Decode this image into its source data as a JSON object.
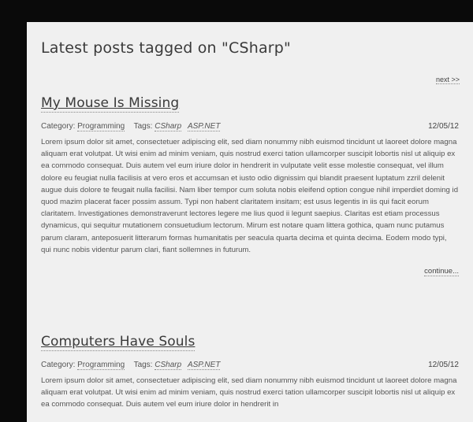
{
  "header": {
    "title": "Latest posts tagged on \"CSharp\"",
    "next_label": "next >>"
  },
  "posts": [
    {
      "title": "My Mouse Is Missing",
      "category_label": "Category:",
      "category": "Programming",
      "tags_label": "Tags:",
      "tags": [
        "CSharp",
        "ASP.NET"
      ],
      "date": "12/05/12",
      "body": "Lorem ipsum dolor sit amet, consectetuer adipiscing elit, sed diam nonummy nibh euismod tincidunt ut laoreet dolore magna aliquam erat volutpat. Ut wisi enim ad minim veniam, quis nostrud exerci tation ullamcorper suscipit lobortis nisl ut aliquip ex ea commodo consequat. Duis autem vel eum iriure dolor in hendrerit in vulputate velit esse molestie consequat, vel illum dolore eu feugiat nulla facilisis at vero eros et accumsan et iusto odio dignissim qui blandit praesent luptatum zzril delenit augue duis dolore te feugait nulla facilisi. Nam liber tempor cum soluta nobis eleifend option congue nihil imperdiet doming id quod mazim placerat facer possim assum. Typi non habent claritatem insitam; est usus legentis in iis qui facit eorum claritatem. Investigationes demonstraverunt lectores legere me lius quod ii legunt saepius. Claritas est etiam processus dynamicus, qui sequitur mutationem consuetudium lectorum. Mirum est notare quam littera gothica, quam nunc putamus parum claram, anteposuerit litterarum formas humanitatis per seacula quarta decima et quinta decima. Eodem modo typi, qui nunc nobis videntur parum clari, fiant sollemnes in futurum.",
      "continue_label": "continue..."
    },
    {
      "title": "Computers Have Souls",
      "category_label": "Category:",
      "category": "Programming",
      "tags_label": "Tags:",
      "tags": [
        "CSharp",
        "ASP.NET"
      ],
      "date": "12/05/12",
      "body": "Lorem ipsum dolor sit amet, consectetuer adipiscing elit, sed diam nonummy nibh euismod tincidunt ut laoreet dolore magna aliquam erat volutpat. Ut wisi enim ad minim veniam, quis nostrud exerci tation ullamcorper suscipit lobortis nisl ut aliquip ex ea commodo consequat. Duis autem vel eum iriure dolor in hendrerit in"
    }
  ]
}
